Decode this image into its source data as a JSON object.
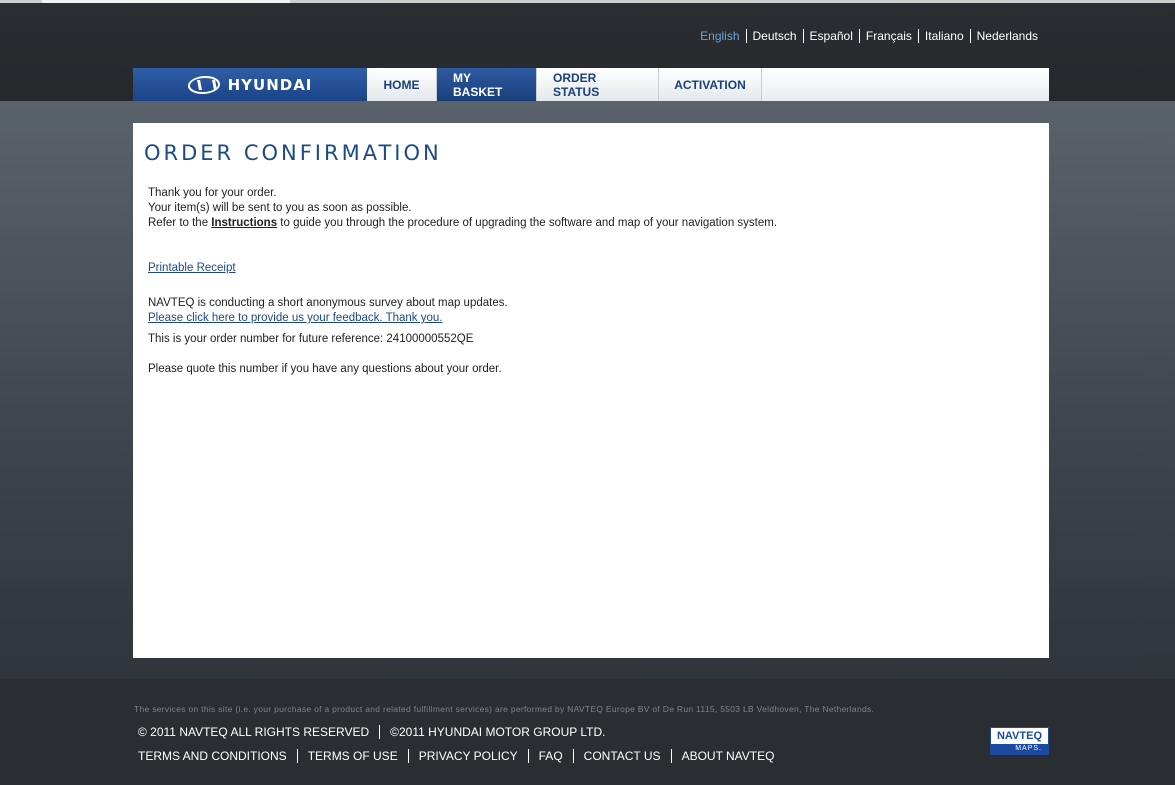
{
  "languages": {
    "items": [
      "English",
      "Deutsch",
      "Español",
      "Français",
      "Italiano",
      "Nederlands"
    ],
    "active": "English"
  },
  "nav": {
    "logo_text": "HYUNDAI",
    "tabs": [
      "HOME",
      "MY BASKET",
      "ORDER STATUS",
      "ACTIVATION"
    ],
    "active_tab": "MY BASKET"
  },
  "main": {
    "title": "ORDER CONFIRMATION",
    "line1": "Thank you for your order.",
    "line2": "Your item(s) will be sent to you as soon as possible.",
    "line3_prefix": "Refer to the ",
    "instructions_link": "Instructions",
    "line3_suffix": " to guide you through the procedure of upgrading the software and map of your navigation system.",
    "printable_receipt": "Printable Receipt",
    "survey_text": "NAVTEQ is conducting a short anonymous survey about map updates.",
    "survey_link": "Please click here to provide us your feedback. Thank you.",
    "order_number_text": "This is your order number for future reference: 24100000552QE",
    "quote_text": "Please quote this number if you have any questions about your order."
  },
  "footer": {
    "disclaimer": "The services on this site (i.e. your purchase of a product and related fulfillment services) are performed by NAVTEQ Europe BV of De Run 1115, 5503 LB Veldhoven, The Netherlands.",
    "copyright_navteq": "© 2011 NAVTEQ ALL RIGHTS RESERVED",
    "copyright_hyundai": "©2011 HYUNDAI MOTOR GROUP LTD.",
    "links": [
      "TERMS AND CONDITIONS",
      "TERMS OF USE",
      "PRIVACY POLICY",
      "FAQ",
      "CONTACT US",
      "ABOUT NAVTEQ"
    ],
    "navteq_logo_top": "NAVTEQ",
    "navteq_logo_bottom": "MAPS."
  },
  "colors": {
    "brand_blue": "#1d4a86",
    "active_language": "#6aa2d8"
  }
}
